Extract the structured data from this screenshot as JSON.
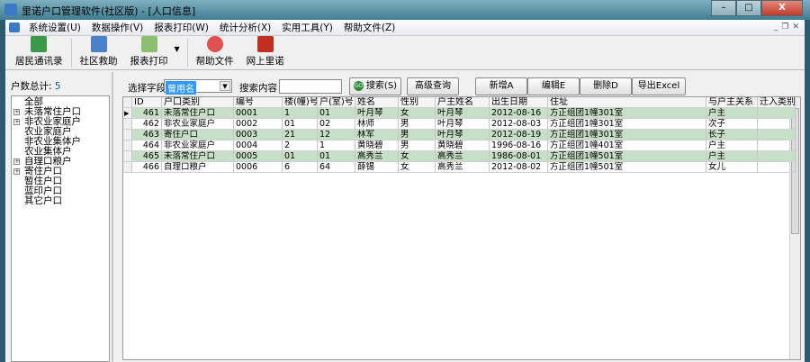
{
  "window": {
    "title": "里诺户口管理软件(社区版) - [人口信息]",
    "min": "–",
    "max": "□",
    "close": "X"
  },
  "menu": [
    "系统设置(U)",
    "数据操作(V)",
    "报表打印(W)",
    "统计分析(X)",
    "实用工具(Y)",
    "帮助文件(Z)"
  ],
  "toolbar": [
    "居民通讯录",
    "社区救助",
    "报表打印",
    "帮助文件",
    "网上里诺"
  ],
  "left": {
    "count_label": "户数总计:",
    "count": "5",
    "tree": [
      {
        "label": "全部",
        "exp": false
      },
      {
        "label": "未落常住户口",
        "exp": true
      },
      {
        "label": "非农业家庭户",
        "exp": true
      },
      {
        "label": "农业家庭户",
        "exp": false
      },
      {
        "label": "非农业集体户",
        "exp": false
      },
      {
        "label": "农业集体户",
        "exp": false
      },
      {
        "label": "自理口粮户",
        "exp": true
      },
      {
        "label": "寄住户口",
        "exp": true
      },
      {
        "label": "暂住户口",
        "exp": false
      },
      {
        "label": "蓝印户口",
        "exp": false
      },
      {
        "label": "其它户口",
        "exp": false
      }
    ]
  },
  "search": {
    "field_label": "选择字段",
    "field_value": "曾用名",
    "content_label": "搜索内容",
    "content_value": "",
    "go": "GO",
    "search_btn": "搜索(S)",
    "advanced": "高级查询",
    "add": "新增A",
    "edit": "编辑E",
    "delete": "删除D",
    "export": "导出Excel"
  },
  "grid": {
    "columns": [
      "ID",
      "户口类别",
      "编号",
      "楼(幢)号",
      "户(室)号",
      "姓名",
      "性别",
      "户主姓名",
      "出生日期",
      "住址",
      "与户主关系",
      "迁入类别"
    ],
    "rows": [
      [
        "461",
        "未落常住户口",
        "0001",
        "1",
        "01",
        "叶月琴",
        "女",
        "叶月琴",
        "2012-08-16",
        "方正组团1幢301室",
        "户主",
        ""
      ],
      [
        "462",
        "非农业家庭户",
        "0002",
        "01",
        "02",
        "林师",
        "男",
        "叶月琴",
        "2012-08-03",
        "方正组团1幢301室",
        "次子",
        ""
      ],
      [
        "463",
        "寄住户口",
        "0003",
        "21",
        "12",
        "林军",
        "男",
        "叶月琴",
        "2012-08-19",
        "方正组团1幢301室",
        "长子",
        ""
      ],
      [
        "464",
        "非农业家庭户",
        "0004",
        "2",
        "1",
        "黄晓碧",
        "男",
        "黄晓碧",
        "1996-08-16",
        "方正组团1幢401室",
        "户主",
        ""
      ],
      [
        "465",
        "未落常住户口",
        "0005",
        "01",
        "01",
        "高秀兰",
        "女",
        "高秀兰",
        "1986-08-01",
        "方正组团1幢501室",
        "户主",
        ""
      ],
      [
        "466",
        "自理口粮户",
        "0006",
        "6",
        "64",
        "薛锡",
        "女",
        "高秀兰",
        "2012-08-02",
        "方正组团1幢501室",
        "女儿",
        ""
      ]
    ]
  }
}
